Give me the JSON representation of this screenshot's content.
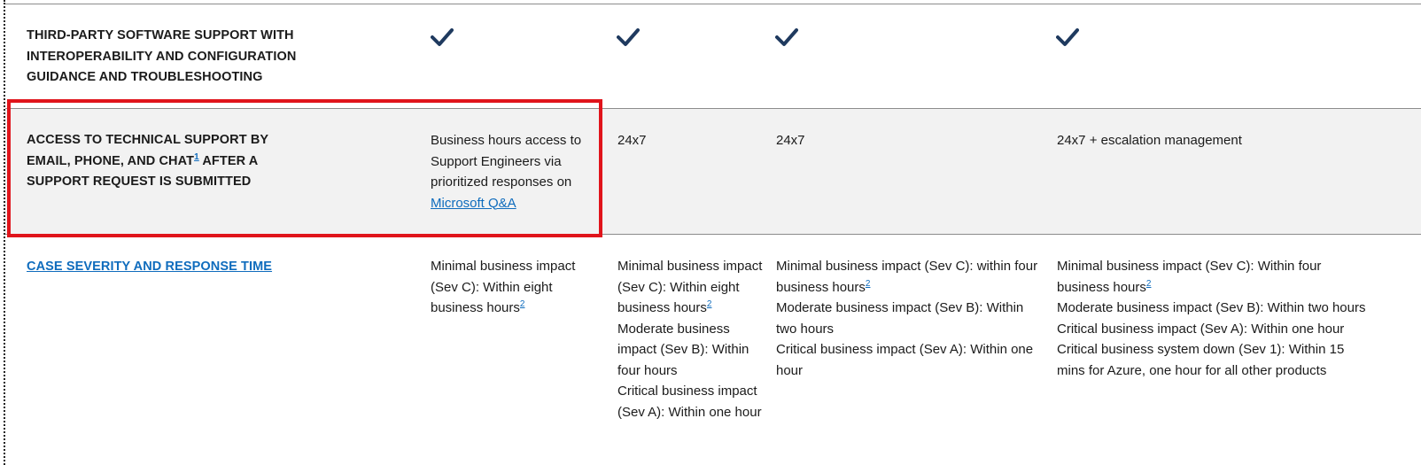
{
  "rows": {
    "third_party": {
      "label": "Third-party software support with interoperability and configuration guidance and troubleshooting",
      "checks": [
        "checkmark-icon",
        "checkmark-icon",
        "checkmark-icon",
        "checkmark-icon"
      ]
    },
    "access": {
      "label_part1": "Access to technical support by email, phone, and chat",
      "footnote": "1",
      "label_part2": " after a support request is submitted",
      "col2_text": "Business hours access to Support Engineers via prioritized responses on",
      "col2_link": "Microsoft Q&A",
      "col3": "24x7",
      "col4": "24x7",
      "col5": "24x7 + escalation management"
    },
    "severity": {
      "label_link": "Case severity and response time",
      "col2": {
        "line1": "Minimal business impact (Sev C): Within eight business hours",
        "footnote": "2"
      },
      "col3": {
        "line1": "Minimal business impact (Sev C): Within eight business hours",
        "footnote": "2",
        "line2": "Moderate business impact (Sev B): Within four hours",
        "line3": "Critical business impact (Sev A): Within one hour"
      },
      "col4": {
        "line1": "Minimal business impact (Sev C): within four business hours",
        "footnote": "2",
        "line2": "Moderate business impact (Sev B): Within two hours",
        "line3": "Critical business impact (Sev A): Within one hour"
      },
      "col5": {
        "line1": "Minimal business impact (Sev C): Within four business hours",
        "footnote": "2",
        "line2": "Moderate business impact (Sev B): Within two hours",
        "line3": "Critical business impact (Sev A): Within one hour",
        "line4": "Critical business system down (Sev 1): Within 15 mins for Azure, one hour for all other products"
      }
    }
  },
  "colors": {
    "check": "#1f3a5f",
    "link": "#0f6cbd",
    "highlight": "#e0141b",
    "shaded_row": "#f2f2f2"
  }
}
